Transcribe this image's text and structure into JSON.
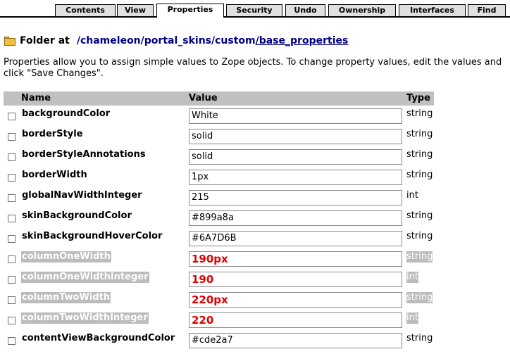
{
  "tabs": [
    {
      "label": "Contents",
      "active": false
    },
    {
      "label": "View",
      "active": false
    },
    {
      "label": "Properties",
      "active": true
    },
    {
      "label": "Security",
      "active": false
    },
    {
      "label": "Undo",
      "active": false
    },
    {
      "label": "Ownership",
      "active": false
    },
    {
      "label": "Interfaces",
      "active": false
    },
    {
      "label": "Find",
      "active": false
    }
  ],
  "breadcrumb": {
    "prefix": "Folder at",
    "parts": [
      "/chameleon",
      "/portal_skins",
      "/custom",
      "/base_properties"
    ]
  },
  "intro": "Properties allow you to assign simple values to Zope objects. To change property values, edit the values and click \"Save Changes\".",
  "table": {
    "headers": {
      "name": "Name",
      "value": "Value",
      "type": "Type"
    },
    "rows": [
      {
        "name": "backgroundColor",
        "value": "White",
        "type": "string",
        "highlighted": false
      },
      {
        "name": "borderStyle",
        "value": "solid",
        "type": "string",
        "highlighted": false
      },
      {
        "name": "borderStyleAnnotations",
        "value": "solid",
        "type": "string",
        "highlighted": false
      },
      {
        "name": "borderWidth",
        "value": "1px",
        "type": "string",
        "highlighted": false
      },
      {
        "name": "globalNavWidthInteger",
        "value": "215",
        "type": "int",
        "highlighted": false
      },
      {
        "name": "skinBackgroundColor",
        "value": "#899a8a",
        "type": "string",
        "highlighted": false
      },
      {
        "name": "skinBackgroundHoverColor",
        "value": "#6A7D6B",
        "type": "string",
        "highlighted": false
      },
      {
        "name": "columnOneWidth",
        "value": "190px",
        "type": "string",
        "highlighted": true
      },
      {
        "name": "columnOneWidthInteger",
        "value": "190",
        "type": "int",
        "highlighted": true
      },
      {
        "name": "columnTwoWidth",
        "value": "220px",
        "type": "string",
        "highlighted": true
      },
      {
        "name": "columnTwoWidthInteger",
        "value": "220",
        "type": "int",
        "highlighted": true
      },
      {
        "name": "contentViewBackgroundColor",
        "value": "#cde2a7",
        "type": "string",
        "highlighted": false
      }
    ]
  },
  "colors": {
    "link": "#000080",
    "highlight_bg": "#bcbcbc",
    "value_red": "#e00000",
    "header_bg": "#c0c0c0"
  }
}
